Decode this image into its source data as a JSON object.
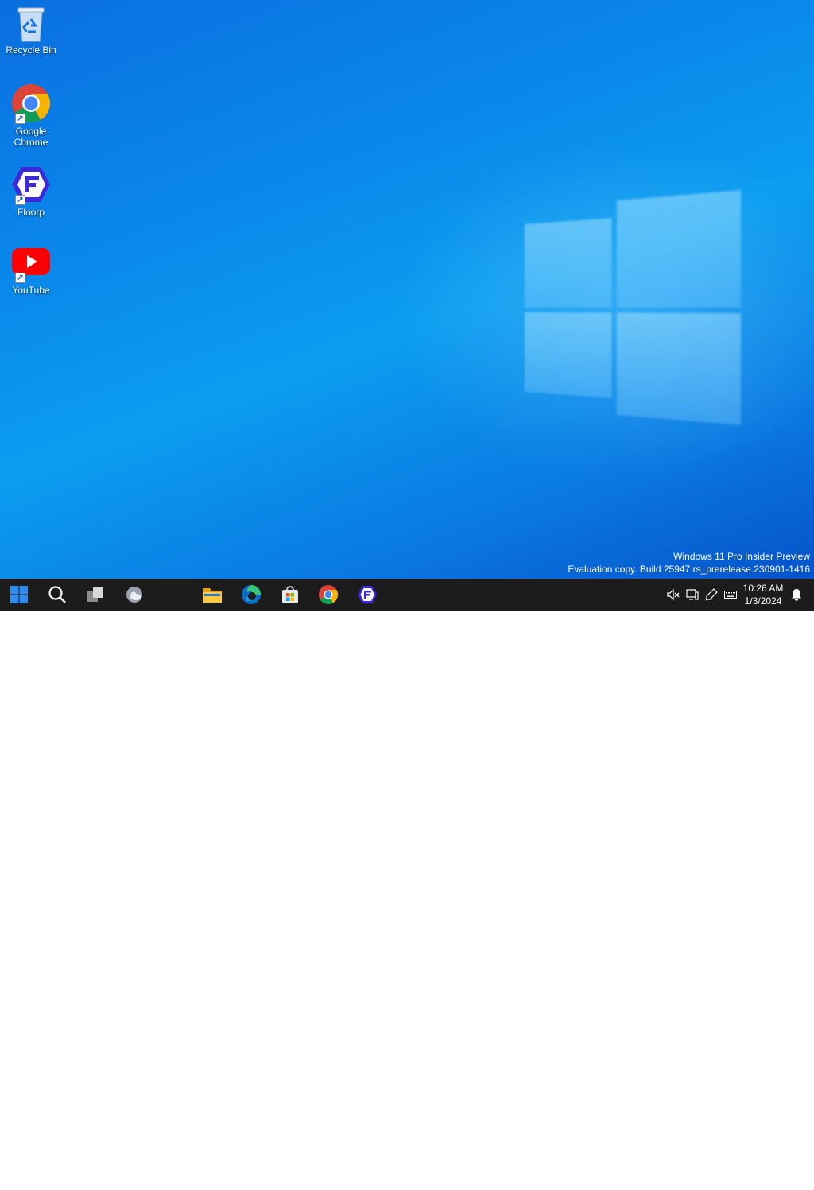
{
  "desktop": {
    "icons": [
      {
        "label": "Recycle Bin",
        "icon": "recycle-bin-icon"
      },
      {
        "label": "Google Chrome",
        "icon": "chrome-icon"
      },
      {
        "label": "Floorp",
        "icon": "floorp-icon"
      },
      {
        "label": "YouTube",
        "icon": "youtube-icon"
      }
    ],
    "watermark": {
      "line1": "Windows 11 Pro Insider Preview",
      "line2": "Evaluation copy. Build 25947.rs_prerelease.230901-1416"
    }
  },
  "taskbar": {
    "buttons": [
      "start-icon",
      "search-icon",
      "task-view-icon",
      "widgets-icon"
    ],
    "pinned_apps": [
      "file-explorer-icon",
      "edge-icon",
      "microsoft-store-icon",
      "chrome-icon",
      "floorp-icon"
    ],
    "tray_icons": [
      "volume-muted-icon",
      "network-icon",
      "pen-icon",
      "keyboard-icon"
    ],
    "clock": {
      "time": "10:26 AM",
      "date": "1/3/2024"
    },
    "notification_icon": "bell-icon"
  },
  "colors": {
    "taskbar_bg": "#1c1c1c",
    "desktop_blue": "#0b9df0",
    "chrome_red": "#db4437",
    "chrome_green": "#0f9d58",
    "chrome_yellow": "#f4b400",
    "chrome_blue": "#4285f4",
    "youtube_red": "#ff0000",
    "floorp_purple": "#3b2ad8"
  }
}
